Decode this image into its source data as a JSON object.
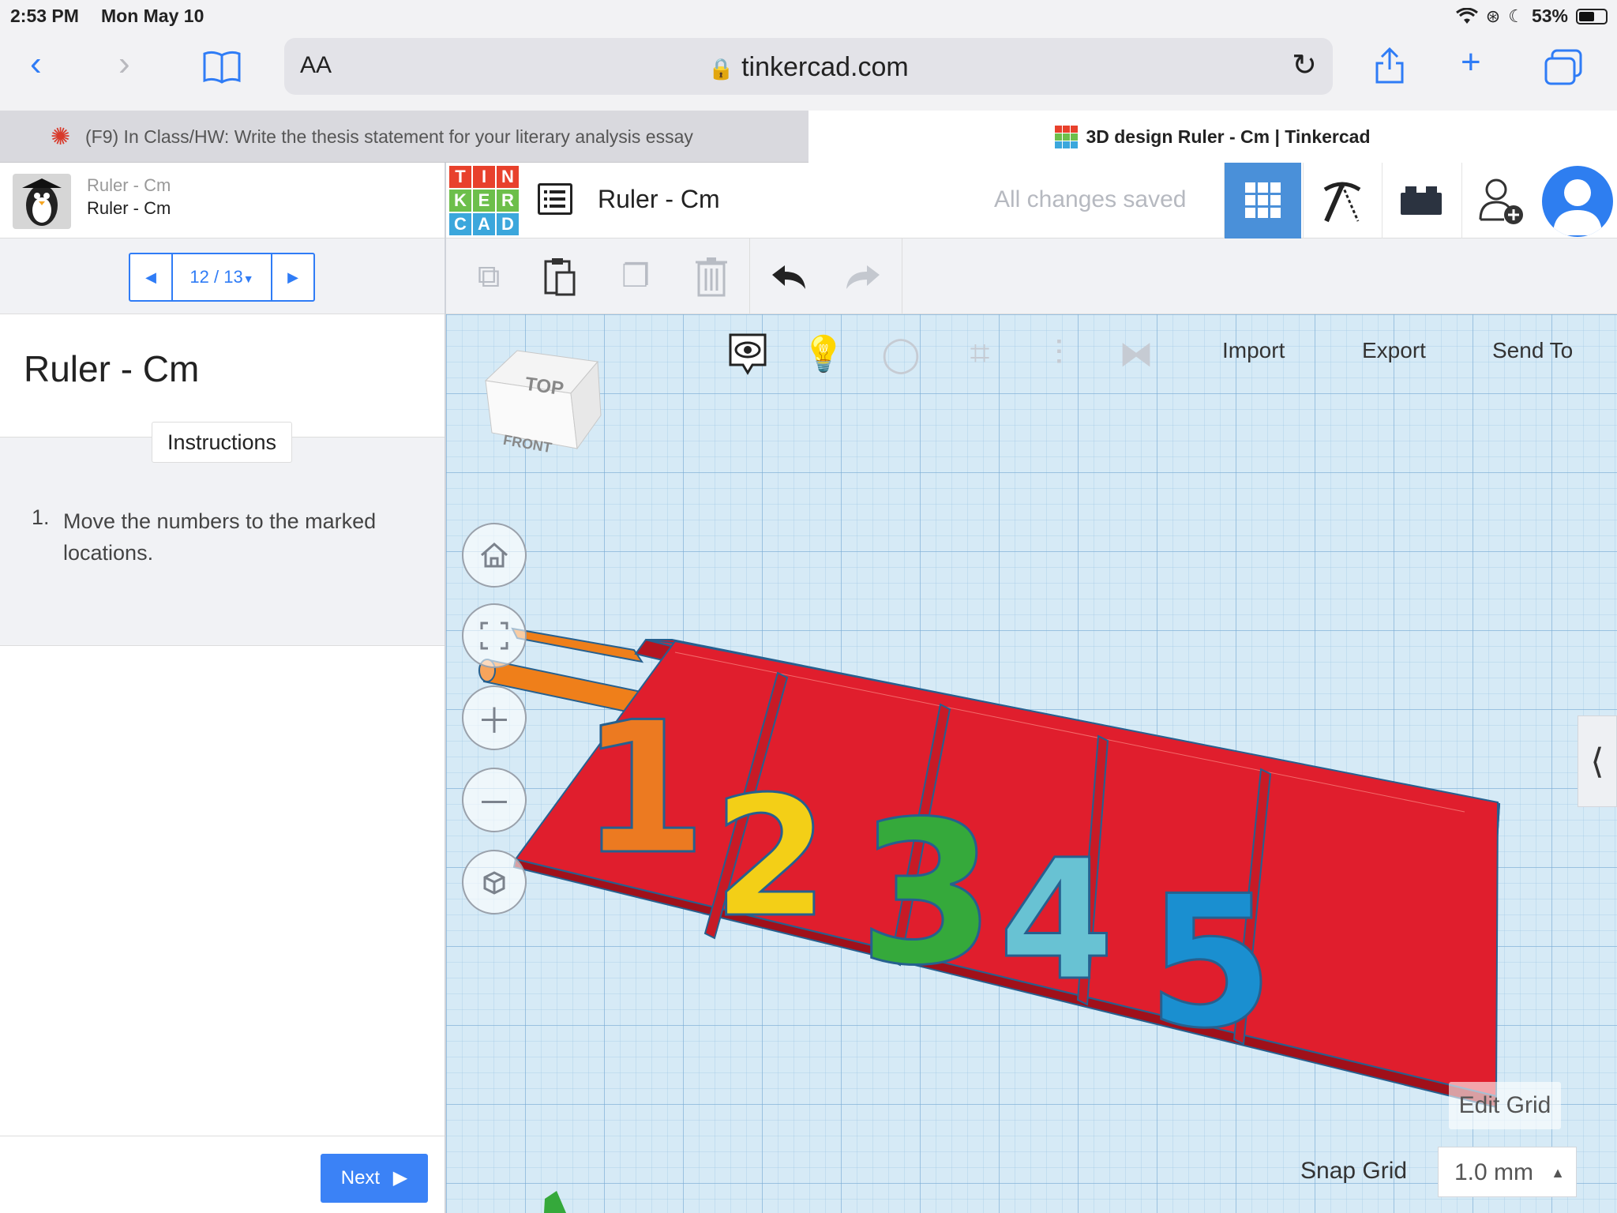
{
  "status_bar": {
    "time": "2:53 PM",
    "date": "Mon May 10",
    "battery": "53%"
  },
  "browser": {
    "aa_label": "AA",
    "url": "tinkercad.com",
    "tabs": [
      {
        "title": "(F9) In Class/HW: Write the thesis statement for your literary analysis essay"
      },
      {
        "title": "3D design Ruler - Cm | Tinkercad"
      }
    ],
    "close_glyph": "×"
  },
  "lesson": {
    "header_title_small": "Ruler - Cm",
    "header_title": "Ruler - Cm",
    "pager": "12 / 13",
    "title": "Ruler - Cm",
    "instructions_tab": "Instructions",
    "steps": [
      {
        "num": "1.",
        "text": "Move the numbers to the marked locations."
      }
    ],
    "next_label": "Next"
  },
  "tinkercad": {
    "logo_letters": [
      "T",
      "I",
      "N",
      "K",
      "E",
      "R",
      "C",
      "A",
      "D"
    ],
    "logo_colors": [
      "#e8412c",
      "#e8412c",
      "#e8412c",
      "#6dbf4b",
      "#6dbf4b",
      "#6dbf4b",
      "#3ba7dc",
      "#3ba7dc",
      "#3ba7dc"
    ],
    "design_title": "Ruler - Cm",
    "save_status": "All changes saved",
    "menu": {
      "import": "Import",
      "export": "Export",
      "send_to": "Send To"
    },
    "edit_grid": "Edit Grid",
    "snap_grid_label": "Snap Grid",
    "snap_grid_value": "1.0 mm",
    "numbers": [
      "1",
      "2",
      "3",
      "4",
      "5"
    ],
    "number_colors": [
      "#ec7a21",
      "#f3cf17",
      "#35a93b",
      "#68c2d3",
      "#1a8fd0"
    ],
    "view_cube": {
      "top": "TOP",
      "front": "FRONT"
    }
  },
  "colors": {
    "accent": "#2f7cf6",
    "grid_active": "#4a90d9",
    "board_red": "#e01e2d",
    "rod_orange": "#ef7f1a"
  }
}
